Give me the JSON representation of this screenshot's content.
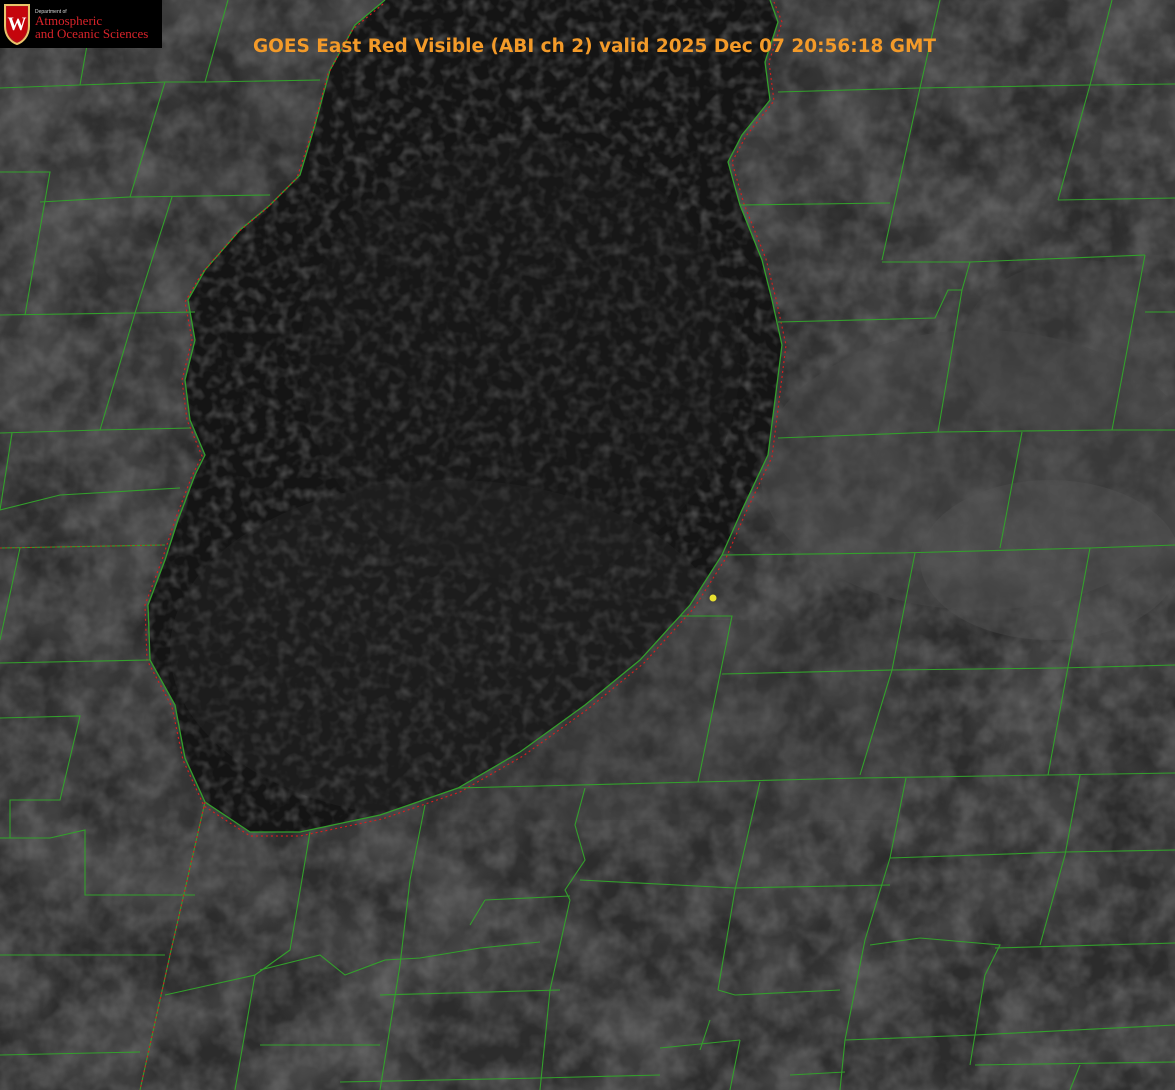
{
  "image": {
    "title": "GOES East Red Visible (ABI ch 2) valid 2025 Dec 07 20:56:18 GMT"
  },
  "logo": {
    "department": "Department of",
    "line1": "Atmospheric",
    "line2": "and Oceanic Sciences",
    "shield_letter": "W"
  },
  "colors": {
    "title": "#f39a29",
    "boundaries": "#33a02c",
    "lake_shoreline": "#d01f1f",
    "marker": "#e8e030",
    "logo_red": "#d8232a"
  }
}
